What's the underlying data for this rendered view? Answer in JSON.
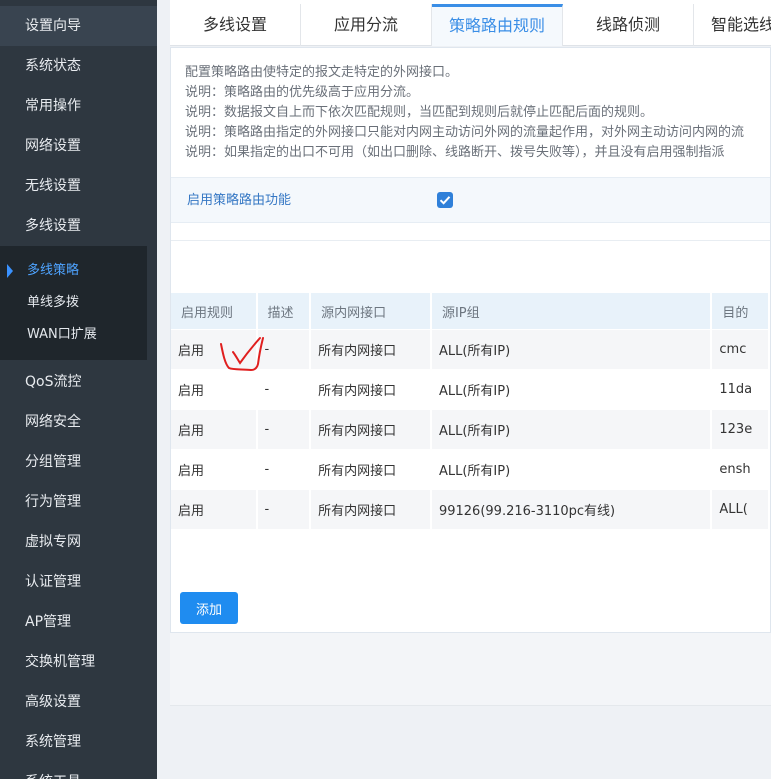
{
  "sidebar": {
    "items_top": [
      {
        "label": "设置向导",
        "name": "sidebar-item-setup-wizard"
      },
      {
        "label": "系统状态",
        "name": "sidebar-item-system-status"
      },
      {
        "label": "常用操作",
        "name": "sidebar-item-common-operations"
      },
      {
        "label": "网络设置",
        "name": "sidebar-item-network-settings"
      },
      {
        "label": "无线设置",
        "name": "sidebar-item-wireless-settings"
      },
      {
        "label": "多线设置",
        "name": "sidebar-item-multiline-settings"
      }
    ],
    "submenu": [
      {
        "label": "多线策略",
        "active": true
      },
      {
        "label": "单线多拨",
        "active": false
      },
      {
        "label": "WAN口扩展",
        "active": false
      }
    ],
    "items_bottom": [
      {
        "label": "QoS流控"
      },
      {
        "label": "网络安全"
      },
      {
        "label": "分组管理"
      },
      {
        "label": "行为管理"
      },
      {
        "label": "虚拟专网"
      },
      {
        "label": "认证管理"
      },
      {
        "label": "AP管理"
      },
      {
        "label": "交换机管理"
      },
      {
        "label": "高级设置"
      },
      {
        "label": "系统管理"
      },
      {
        "label": "系统工具"
      }
    ]
  },
  "tabs": [
    {
      "label": "多线设置",
      "active": false
    },
    {
      "label": "应用分流",
      "active": false
    },
    {
      "label": "策略路由规则",
      "active": true
    },
    {
      "label": "线路侦测",
      "active": false
    },
    {
      "label": "智能选线",
      "active": false
    }
  ],
  "description": [
    "配置策略路由使特定的报文走特定的外网接口。",
    "说明：策略路由的优先级高于应用分流。",
    "说明：数据报文自上而下依次匹配规则，当匹配到规则后就停止匹配后面的规则。",
    "说明：策略路由指定的外网接口只能对内网主动访问外网的流量起作用，对外网主动访问内网的流",
    "说明：如果指定的出口不可用（如出口删除、线路断开、拨号失败等），并且没有启用强制指派"
  ],
  "enable": {
    "label": "启用策略路由功能",
    "checked": true
  },
  "table": {
    "headers": [
      "启用规则",
      "描述",
      "源内网接口",
      "源IP组",
      "目的"
    ],
    "rows": [
      [
        "启用",
        "-",
        "所有内网接口",
        "ALL(所有IP)",
        "cmc"
      ],
      [
        "启用",
        "-",
        "所有内网接口",
        "ALL(所有IP)",
        "11da"
      ],
      [
        "启用",
        "-",
        "所有内网接口",
        "ALL(所有IP)",
        "123e"
      ],
      [
        "启用",
        "-",
        "所有内网接口",
        "ALL(所有IP)",
        "ensh"
      ],
      [
        "启用",
        "-",
        "所有内网接口",
        "99126(99.216-3110pc有线)",
        "ALL("
      ]
    ]
  },
  "add_button_label": "添加",
  "colors": {
    "sidebar_bg": "#2e3740",
    "submenu_bg": "#1f262c",
    "accent": "#1f8cf0",
    "annotation": "#e01f1f"
  }
}
